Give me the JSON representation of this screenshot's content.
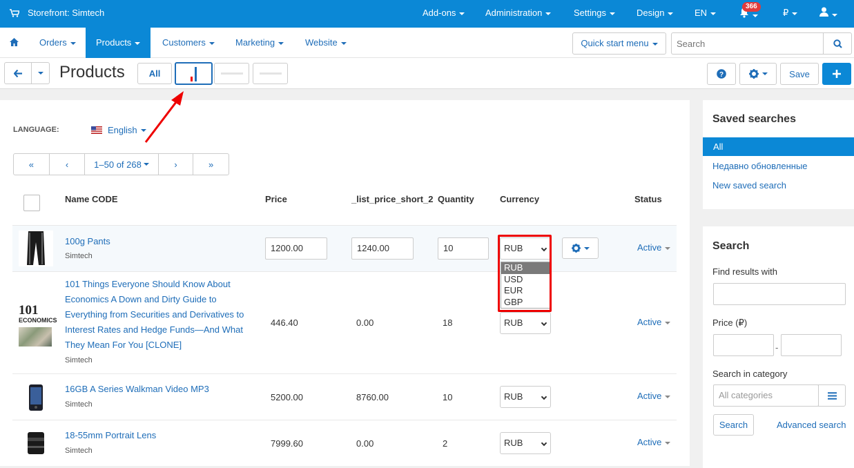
{
  "topbar": {
    "brand": "Storefront: Simtech",
    "menu": [
      "Add-ons",
      "Administration",
      "Settings",
      "Design",
      "EN"
    ],
    "notifications": "366",
    "currency": "₽"
  },
  "nav": {
    "items": [
      "Orders",
      "Products",
      "Customers",
      "Marketing",
      "Website"
    ],
    "quick_start": "Quick start menu",
    "search_placeholder": "Search"
  },
  "toolbar": {
    "title": "Products",
    "view_all": "All",
    "save": "Save"
  },
  "filters": {
    "language_label": "LANGUAGE:",
    "language_value": "English",
    "pager_range": "1–50 of 268"
  },
  "table": {
    "headers": [
      "Name CODE",
      "Price",
      "_list_price_short_2",
      "Quantity",
      "Currency",
      "Status"
    ],
    "rows": [
      {
        "name": "100g Pants",
        "vendor": "Simtech",
        "price": "1200.00",
        "list_price": "1240.00",
        "qty": "10",
        "currency": "RUB",
        "status": "Active"
      },
      {
        "name": "101 Things Everyone Should Know About Economics A Down and Dirty Guide to Everything from Securities and Derivatives to Interest Rates and Hedge Funds—And What They Mean For You [CLONE]",
        "vendor": "Simtech",
        "price": "446.40",
        "list_price": "0.00",
        "qty": "18",
        "currency": "RUB",
        "status": "Active"
      },
      {
        "name": "16GB A Series Walkman Video MP3",
        "vendor": "Simtech",
        "price": "5200.00",
        "list_price": "8760.00",
        "qty": "10",
        "currency": "RUB",
        "status": "Active"
      },
      {
        "name": "18-55mm Portrait Lens",
        "vendor": "Simtech",
        "price": "7999.60",
        "list_price": "0.00",
        "qty": "2",
        "currency": "RUB",
        "status": "Active"
      }
    ],
    "currency_options": [
      "RUB",
      "USD",
      "EUR",
      "GBP"
    ]
  },
  "book_thumb": {
    "line1": "101",
    "line2": "ECONOMICS"
  },
  "saved_searches": {
    "title": "Saved searches",
    "items": [
      "All",
      "Недавно обновленные",
      "New saved search"
    ]
  },
  "search_panel": {
    "title": "Search",
    "find_label": "Find results with",
    "price_label": "Price (₽)",
    "price_dash": "-",
    "category_label": "Search in category",
    "category_placeholder": "All categories",
    "search_button": "Search",
    "advanced": "Advanced search"
  },
  "colors": {
    "primary": "#0b88d6",
    "link": "#1e6db8",
    "annotation": "#e00000"
  }
}
